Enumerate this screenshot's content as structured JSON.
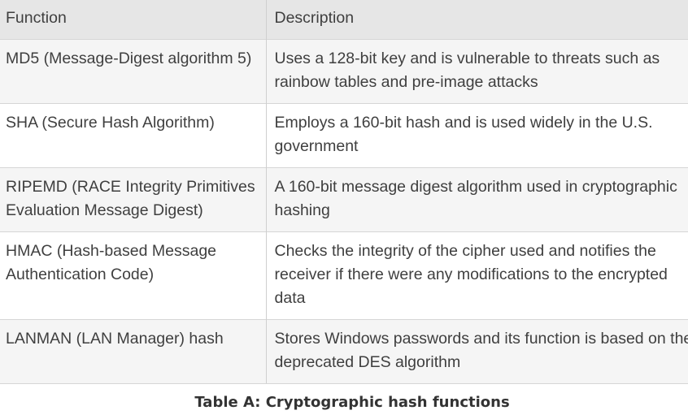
{
  "table": {
    "headers": [
      "Function",
      "Description"
    ],
    "rows": [
      {
        "function": "MD5 (Message-Digest algorithm 5)",
        "description": "Uses a 128-bit key and is vulnerable to threats such as rainbow tables and pre-image attacks"
      },
      {
        "function": "SHA (Secure Hash Algorithm)",
        "description": "Employs a 160-bit hash and is used widely in the U.S. government"
      },
      {
        "function": "RIPEMD (RACE Integrity Primitives Evaluation Message Digest)",
        "description_line1": "A 160-bit message digest algorithm used in cryptographic",
        "description_line2": "hashing"
      },
      {
        "function": "HMAC (Hash-based Message Authentication Code)",
        "description": "Checks the integrity of the cipher used and notifies the receiver if there were any modifications to the encrypted data"
      },
      {
        "function": "LANMAN (LAN Manager) hash",
        "description": "Stores Windows passwords and its function is based on the deprecated DES algorithm"
      }
    ]
  },
  "caption": "Table A: Cryptographic hash functions"
}
